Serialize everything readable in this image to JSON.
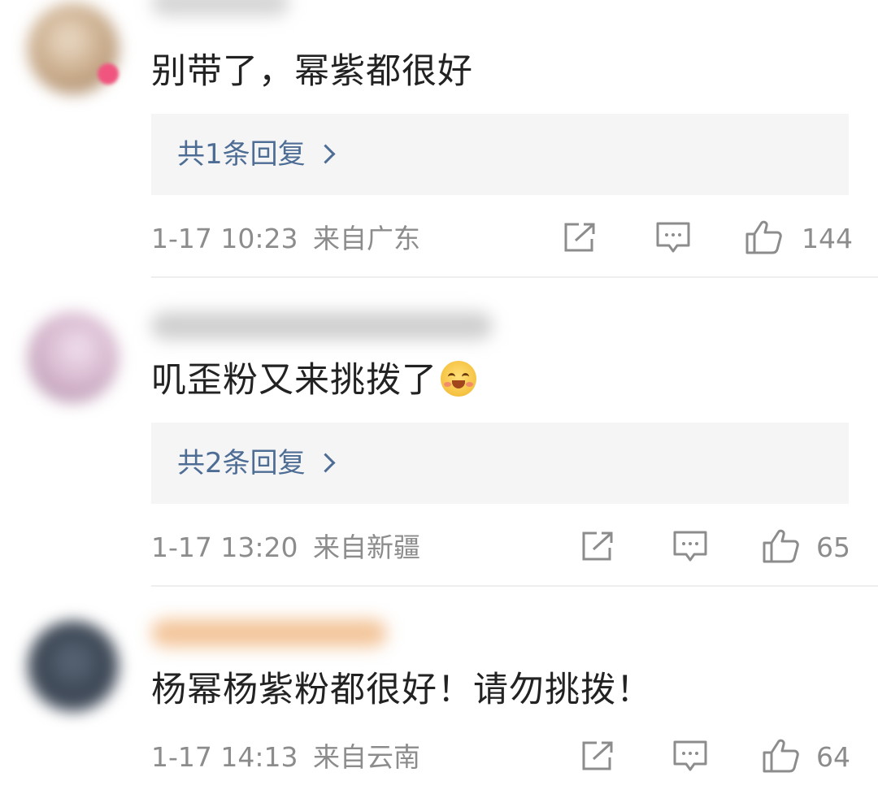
{
  "comments": [
    {
      "text": "别带了，幂紫都很好",
      "reply_link": "共1条回复",
      "time": "1-17 10:23",
      "location": "来自广东",
      "likes": "144"
    },
    {
      "text": "叽歪粉又来挑拨了",
      "reply_link": "共2条回复",
      "time": "1-17 13:20",
      "location": "来自新疆",
      "likes": "65"
    },
    {
      "text": "杨幂杨紫粉都很好！请勿挑拨！",
      "time": "1-17 14:13",
      "location": "来自云南",
      "likes": "64"
    }
  ],
  "icons": {
    "share": "share-icon",
    "comment": "comment-icon",
    "like": "thumbs-up-icon",
    "emoji": "hugging-face-emoji"
  },
  "colors": {
    "reply_link": "#4e6d94",
    "meta_text": "#8c8c8c",
    "body_text": "#222222",
    "reply_box": "#f5f5f6"
  }
}
